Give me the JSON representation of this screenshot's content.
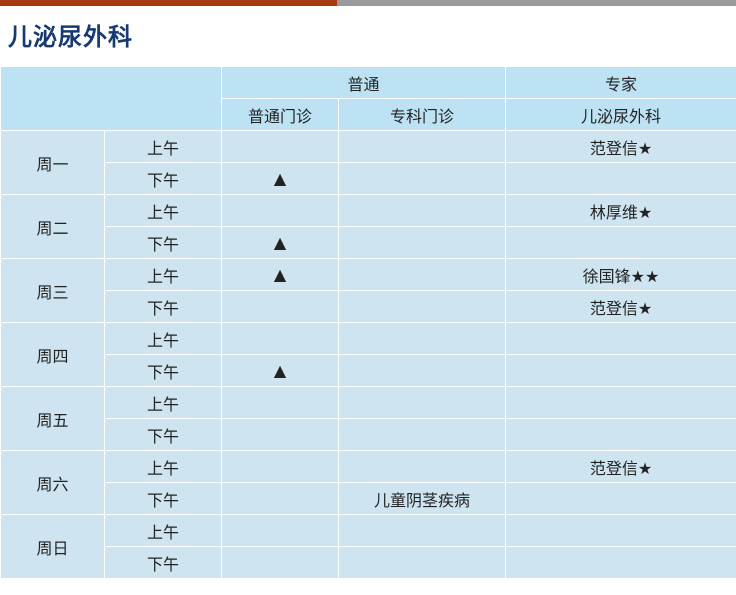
{
  "page": {
    "title": "儿泌尿外科"
  },
  "header": {
    "group_general": "普通",
    "group_expert": "专家",
    "col_general_clinic": "普通门诊",
    "col_special_clinic": "专科门诊",
    "col_expert_dept": "儿泌尿外科"
  },
  "colors": {
    "accent_bar": "#a63a0e",
    "bar_gray": "#9a9a9a",
    "title": "#173a73",
    "header_bg": "#bde2f3",
    "cell_bg": "#cfe4f1"
  },
  "rows": [
    {
      "day": "周一",
      "am": {
        "period": "上午",
        "general": "",
        "special": "",
        "expert": "范登信★"
      },
      "pm": {
        "period": "下午",
        "general": "▲",
        "special": "",
        "expert": ""
      }
    },
    {
      "day": "周二",
      "am": {
        "period": "上午",
        "general": "",
        "special": "",
        "expert": "林厚维★"
      },
      "pm": {
        "period": "下午",
        "general": "▲",
        "special": "",
        "expert": ""
      }
    },
    {
      "day": "周三",
      "am": {
        "period": "上午",
        "general": "▲",
        "special": "",
        "expert": "徐国锋★★"
      },
      "pm": {
        "period": "下午",
        "general": "",
        "special": "",
        "expert": "范登信★"
      }
    },
    {
      "day": "周四",
      "am": {
        "period": "上午",
        "general": "",
        "special": "",
        "expert": ""
      },
      "pm": {
        "period": "下午",
        "general": "▲",
        "special": "",
        "expert": ""
      }
    },
    {
      "day": "周五",
      "am": {
        "period": "上午",
        "general": "",
        "special": "",
        "expert": ""
      },
      "pm": {
        "period": "下午",
        "general": "",
        "special": "",
        "expert": ""
      }
    },
    {
      "day": "周六",
      "am": {
        "period": "上午",
        "general": "",
        "special": "",
        "expert": "范登信★"
      },
      "pm": {
        "period": "下午",
        "general": "",
        "special": "儿童阴茎疾病",
        "expert": ""
      }
    },
    {
      "day": "周日",
      "am": {
        "period": "上午",
        "general": "",
        "special": "",
        "expert": ""
      },
      "pm": {
        "period": "下午",
        "general": "",
        "special": "",
        "expert": ""
      }
    }
  ]
}
